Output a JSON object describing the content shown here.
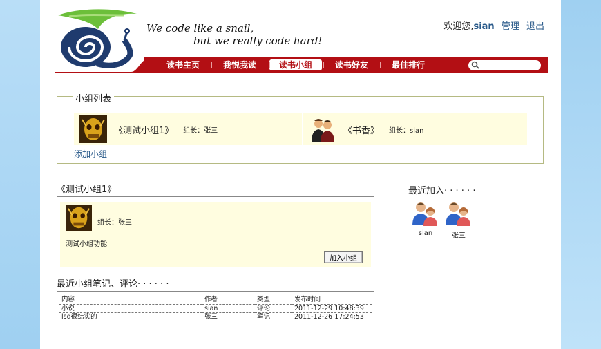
{
  "header": {
    "slogan_line1": "We code like a snail,",
    "slogan_line2": "but we really code hard!",
    "welcome": "欢迎您,",
    "username": "sian",
    "admin_link": "管理",
    "logout_link": "退出"
  },
  "nav": {
    "items": [
      {
        "label": "读书主页"
      },
      {
        "label": "我悦我读"
      },
      {
        "label": "读书小组",
        "active": true
      },
      {
        "label": "读书好友"
      },
      {
        "label": "最佳排行"
      }
    ],
    "search_placeholder": ""
  },
  "group_list": {
    "legend": "小组列表",
    "groups": [
      {
        "name": "《测试小组1》",
        "owner": "组长：张三",
        "icon": "golden-skull-avatar"
      },
      {
        "name": "《书香》",
        "owner": "组长：sian",
        "icon": "people-avatar"
      }
    ],
    "add_link": "添加小组"
  },
  "group_detail": {
    "title": "《测试小组1》",
    "owner": "组长：张三",
    "description": "测试小组功能",
    "join_button": "加入小组"
  },
  "notes": {
    "title": "最近小组笔记、评论· · · · · ·",
    "columns": [
      "内容",
      "作者",
      "类型",
      "发布时间"
    ],
    "rows": [
      [
        "小说",
        "sian",
        "评论",
        "2011-12-29 10:48:39"
      ],
      [
        "lsd很结实的",
        "张三",
        "笔记",
        "2011-12-26 17:24:53"
      ]
    ]
  },
  "recent_joins": {
    "title": "最近加入· · · · · ·",
    "members": [
      {
        "name": "sian",
        "icon": "user-pair-icon"
      },
      {
        "name": "张三",
        "icon": "user-pair-icon"
      }
    ]
  },
  "colors": {
    "nav_red": "#b30f14",
    "card_bg": "#fffde0",
    "link_blue": "#2a5a8a"
  }
}
